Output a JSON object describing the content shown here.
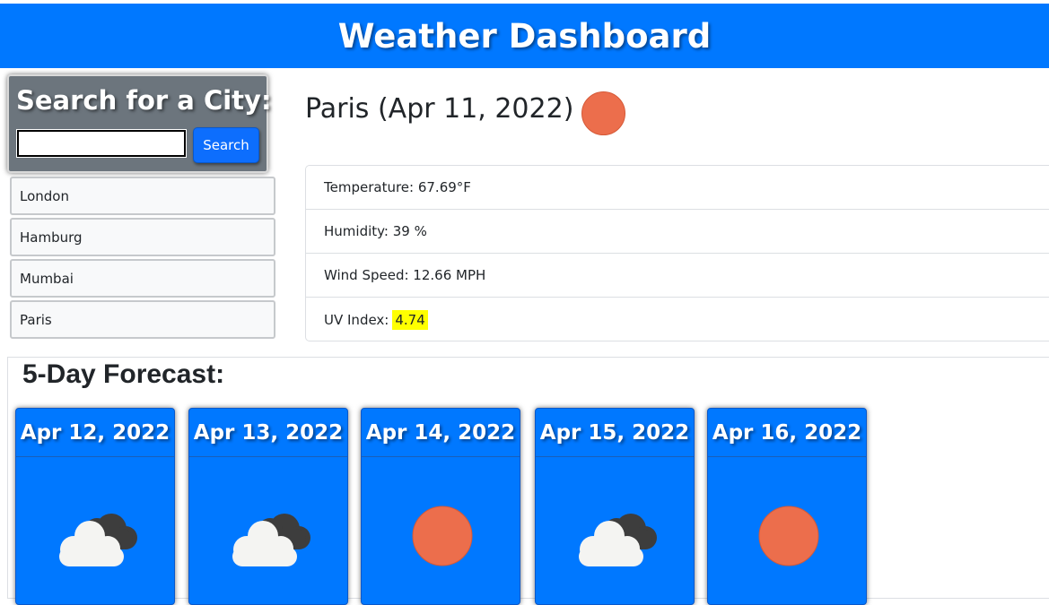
{
  "header": {
    "title": "Weather Dashboard"
  },
  "search": {
    "title": "Search for a City:",
    "input_value": "",
    "placeholder": "",
    "button_label": "Search"
  },
  "history": [
    "London",
    "Hamburg",
    "Mumbai",
    "Paris"
  ],
  "current": {
    "city_heading": "Paris (Apr 11, 2022)",
    "icon": "sun-icon",
    "temperature": "Temperature: 67.69°F",
    "humidity": "Humidity: 39 %",
    "wind": "Wind Speed: 12.66 MPH",
    "uv_label": "UV Index:",
    "uv_value": "4.74",
    "uv_color": "#ffff00"
  },
  "forecast": {
    "title": "5-Day Forecast:",
    "days": [
      {
        "date": "Apr 12, 2022",
        "icon": "cloud-icon"
      },
      {
        "date": "Apr 13, 2022",
        "icon": "cloud-icon"
      },
      {
        "date": "Apr 14, 2022",
        "icon": "sun-icon"
      },
      {
        "date": "Apr 15, 2022",
        "icon": "cloud-icon"
      },
      {
        "date": "Apr 16, 2022",
        "icon": "sun-icon"
      }
    ]
  },
  "colors": {
    "header_bg": "#0078ff",
    "card_bg": "#0078ff",
    "panel_bg": "#6c757d",
    "sun": "#ec6e4c"
  }
}
